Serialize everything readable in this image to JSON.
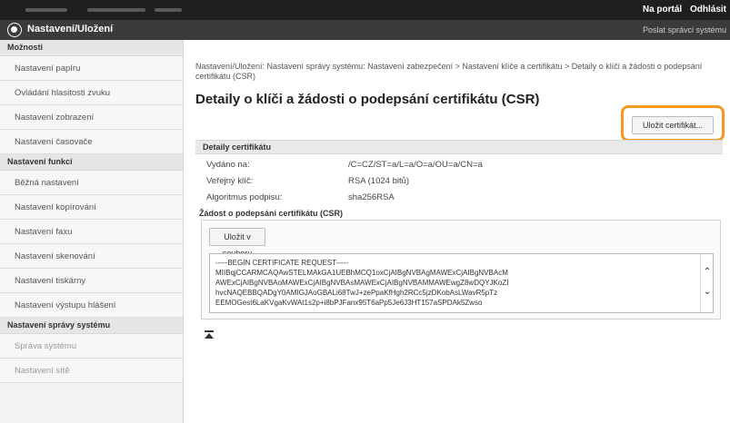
{
  "topbar": {
    "portal_link": "Na portál",
    "logout_link": "Odhlásit"
  },
  "header": {
    "title": "Nastavení/Uložení",
    "right_link": "Poslat správci systému",
    "icon": "settings-icon"
  },
  "sidebar": {
    "sections": [
      {
        "title": "Možnosti",
        "items": [
          {
            "label": "Nastavení papíru",
            "dim": false
          },
          {
            "label": "Ovládání hlasitosti zvuku",
            "dim": false
          },
          {
            "label": "Nastavení zobrazení",
            "dim": false
          },
          {
            "label": "Nastavení časovače",
            "dim": false
          }
        ]
      },
      {
        "title": "Nastavení funkcí",
        "items": [
          {
            "label": "Běžná nastavení",
            "dim": false
          },
          {
            "label": "Nastavení kopírování",
            "dim": false
          },
          {
            "label": "Nastavení faxu",
            "dim": false
          },
          {
            "label": "Nastavení skenování",
            "dim": false
          },
          {
            "label": "Nastavení tiskárny",
            "dim": false
          },
          {
            "label": "Nastavení výstupu hlášení",
            "dim": false
          }
        ]
      },
      {
        "title": "Nastavení správy systému",
        "items": [
          {
            "label": "Správa systému",
            "dim": true
          },
          {
            "label": "Nastavení sítě",
            "dim": true
          }
        ]
      }
    ]
  },
  "main": {
    "breadcrumb": "Nastavení/Uložení: Nastavení správy systému: Nastavení zabezpečení > Nastavení klíče a certifikátu > Detaily o klíči a žádosti o podepsání certifikátu (CSR)",
    "page_title": "Detaily o klíči a žádosti o podepsání certifikátu (CSR)",
    "save_certificate_label": "Uložit certifikát...",
    "details_heading": "Detaily certifikátu",
    "details": [
      {
        "label": "Vydáno na:",
        "value": "/C=CZ/ST=a/L=a/O=a/OU=a/CN=a"
      },
      {
        "label": "Veřejný klíč:",
        "value": "RSA (1024 bitů)"
      },
      {
        "label": "Algoritmus podpisu:",
        "value": "sha256RSA"
      }
    ],
    "csr_heading": "Žádost o podepsání certifikátu (CSR)",
    "save_file_label": "Uložit v souboru",
    "csr_lines": [
      "-----BEGIN CERTIFICATE REQUEST-----",
      "MIIBqjCCARMCAQAwSTELMAkGA1UEBhMCQ1oxCjAIBgNVBAgMAWExCjAIBgNVBAcM",
      "AWExCjAIBgNVBAoMAWExCjAIBgNVBAsMAWExCjAIBgNVBAMMAWEwgZ8wDQYJKoZI",
      "hvcNAQEBBQADgY0AMIGJAoGBALi68TwJ+zePpaKfHgh2RCc5jzDKobAsLWavR5pTz",
      "EEMOGest6LaKVgaKvWAt1s2p+i8bPJFanx95T6aPp5Je6J3HT157aSPDAk5Zwso"
    ]
  }
}
